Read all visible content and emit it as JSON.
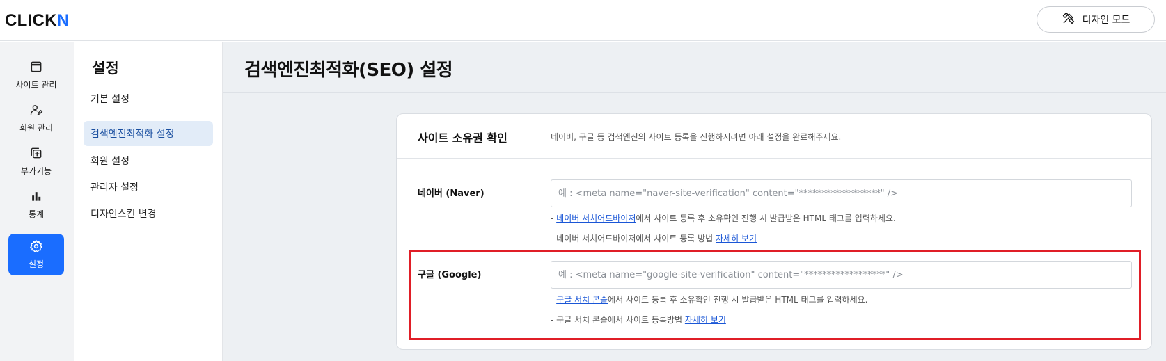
{
  "app": {
    "logo_main": "CLICK",
    "logo_accent": "N",
    "design_mode_label": "디자인 모드"
  },
  "nav": {
    "items": [
      {
        "label": "사이트 관리"
      },
      {
        "label": "회원 관리"
      },
      {
        "label": "부가기능"
      },
      {
        "label": "통계"
      },
      {
        "label": "설정"
      }
    ]
  },
  "subnav": {
    "title": "설정",
    "items": [
      {
        "label": "기본 설정"
      },
      {
        "label": "검색엔진최적화 설정"
      },
      {
        "label": "회원 설정"
      },
      {
        "label": "관리자 설정"
      },
      {
        "label": "디자인스킨 변경"
      }
    ]
  },
  "main": {
    "title": "검색엔진최적화(SEO) 설정"
  },
  "card": {
    "title": "사이트 소유권 확인",
    "description": "네이버, 구글 등 검색엔진의 사이트 등록을 진행하시려면 아래 설정을 완료해주세요.",
    "naver": {
      "label": "네이버 (Naver)",
      "placeholder": "예 : <meta name=\"naver-site-verification\" content=\"******************\" />",
      "help1_link": "네이버 서치어드바이저",
      "help1_text": "에서 사이트 등록 후 소유확인 진행 시 발급받은 HTML 태그를 입력하세요.",
      "help2_text": "네이버 서치어드바이저에서 사이트 등록 방법 ",
      "help2_link": "자세히 보기"
    },
    "google": {
      "label": "구글 (Google)",
      "placeholder": "예 : <meta name=\"google-site-verification\" content=\"******************\" />",
      "help1_link": "구글 서치 콘솔",
      "help1_text": "에서 사이트 등록 후 소유확인 진행 시 발급받은 HTML 태그를 입력하세요.",
      "help2_text": "구글 서치 콘솔에서 사이트 등록방법 ",
      "help2_link": "자세히 보기"
    },
    "bullet": "- ",
    "highlight_color": "#e01e27"
  },
  "colors": {
    "accent": "#1a6dff",
    "link": "#1a56d6"
  }
}
